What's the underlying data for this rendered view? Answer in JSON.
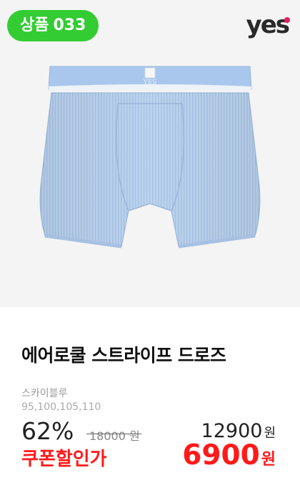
{
  "badge": {
    "prefix": "상품",
    "number": "033"
  },
  "brand": {
    "logo_text": "yes"
  },
  "product": {
    "name": "에어로쿨 스트라이프 드로즈",
    "color": "스카이블루",
    "sizes": "95,100,105,110",
    "waistband_text": "YES"
  },
  "price": {
    "discount": "62%",
    "original": "18000",
    "original_unit": "원",
    "sale": "12900",
    "sale_unit": "원",
    "coupon_label": "쿠폰할인가",
    "final": "6900",
    "final_unit": "원"
  },
  "colors": {
    "badge_bg": "#33cc33",
    "accent_red": "#ff1a1a",
    "garment": "#bcd4ef"
  }
}
